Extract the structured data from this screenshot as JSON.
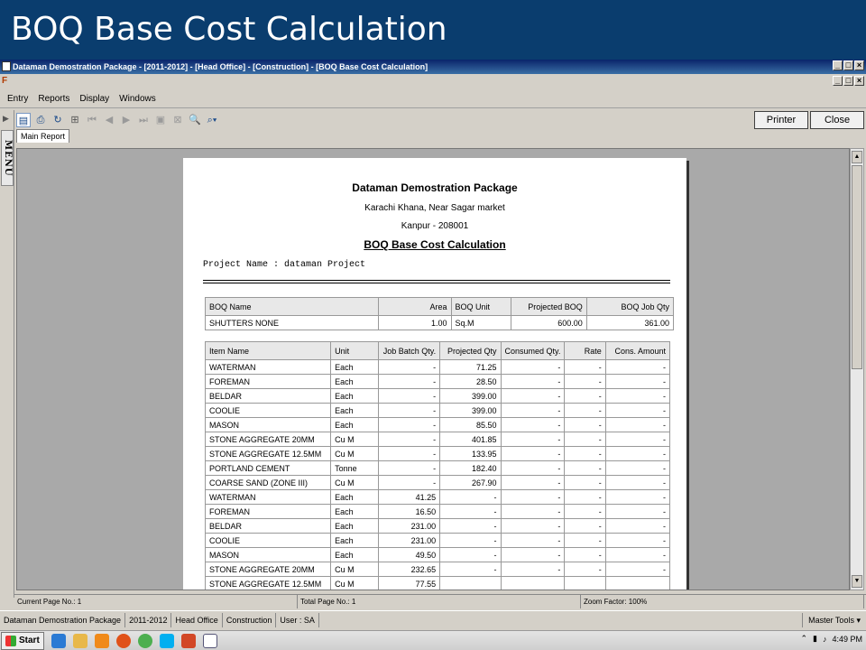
{
  "slide": {
    "title": "BOQ Base Cost Calculation"
  },
  "window": {
    "title": "Dataman Demostration Package - [2011-2012] - [Head Office] - [Construction] - [BOQ Base Cost Calculation]",
    "min": "_",
    "max": "□",
    "close": "×"
  },
  "menu": {
    "items": [
      "Entry",
      "Reports",
      "Display",
      "Windows"
    ]
  },
  "side": {
    "menu_label": "MENU"
  },
  "toolbar": {
    "printer_label": "Printer",
    "close_label": "Close"
  },
  "tabs": {
    "main_report": "Main Report"
  },
  "report": {
    "company": "Dataman Demostration Package",
    "address1": "Karachi Khana, Near Sagar market",
    "address2": "Kanpur - 208001",
    "title": "BOQ Base Cost Calculation",
    "project_line": "Project Name : dataman Project",
    "boq_headers": [
      "BOQ Name",
      "Area",
      "BOQ Unit",
      "Projected BOQ",
      "BOQ Job Qty"
    ],
    "boq_row": [
      "SHUTTERS NONE",
      "1.00",
      "Sq.M",
      "600.00",
      "361.00"
    ],
    "item_headers": [
      "Item Name",
      "Unit",
      "Job Batch Qty.",
      "Projected Qty",
      "Consumed Qty.",
      "Rate",
      "Cons. Amount"
    ],
    "items": [
      [
        "WATERMAN",
        "Each",
        "-",
        "71.25",
        "-",
        "-",
        "-"
      ],
      [
        "FOREMAN",
        "Each",
        "-",
        "28.50",
        "-",
        "-",
        "-"
      ],
      [
        "BELDAR",
        "Each",
        "-",
        "399.00",
        "-",
        "-",
        "-"
      ],
      [
        "COOLIE",
        "Each",
        "-",
        "399.00",
        "-",
        "-",
        "-"
      ],
      [
        "MASON",
        "Each",
        "-",
        "85.50",
        "-",
        "-",
        "-"
      ],
      [
        "STONE AGGREGATE 20MM",
        "Cu M",
        "-",
        "401.85",
        "-",
        "-",
        "-"
      ],
      [
        "STONE AGGREGATE 12.5MM",
        "Cu M",
        "-",
        "133.95",
        "-",
        "-",
        "-"
      ],
      [
        "PORTLAND CEMENT",
        "Tonne",
        "-",
        "182.40",
        "-",
        "-",
        "-"
      ],
      [
        "COARSE SAND (ZONE III)",
        "Cu M",
        "-",
        "267.90",
        "-",
        "-",
        "-"
      ],
      [
        "WATERMAN",
        "Each",
        "41.25",
        "-",
        "-",
        "-",
        "-"
      ],
      [
        "FOREMAN",
        "Each",
        "16.50",
        "-",
        "-",
        "-",
        "-"
      ],
      [
        "BELDAR",
        "Each",
        "231.00",
        "-",
        "-",
        "-",
        "-"
      ],
      [
        "COOLIE",
        "Each",
        "231.00",
        "-",
        "-",
        "-",
        "-"
      ],
      [
        "MASON",
        "Each",
        "49.50",
        "-",
        "-",
        "-",
        "-"
      ],
      [
        "STONE AGGREGATE 20MM",
        "Cu M",
        "232.65",
        "-",
        "-",
        "-",
        "-"
      ],
      [
        "STONE AGGREGATE 12.5MM",
        "Cu M",
        "77.55",
        "",
        "",
        "",
        ""
      ]
    ]
  },
  "status": {
    "current_page": "Current Page No.: 1",
    "total_page": "Total Page No.: 1",
    "zoom": "Zoom Factor: 100%"
  },
  "appstatus": {
    "cells": [
      "Dataman Demostration Package",
      "2011-2012",
      "Head Office",
      "Construction",
      "User : SA"
    ],
    "master_tools": "Master Tools"
  },
  "taskbar": {
    "start": "Start",
    "clock": "4:49 PM"
  },
  "colors": {
    "slide_bg": "#0a3d6e",
    "viewer_bg": "#a9a9a9"
  }
}
